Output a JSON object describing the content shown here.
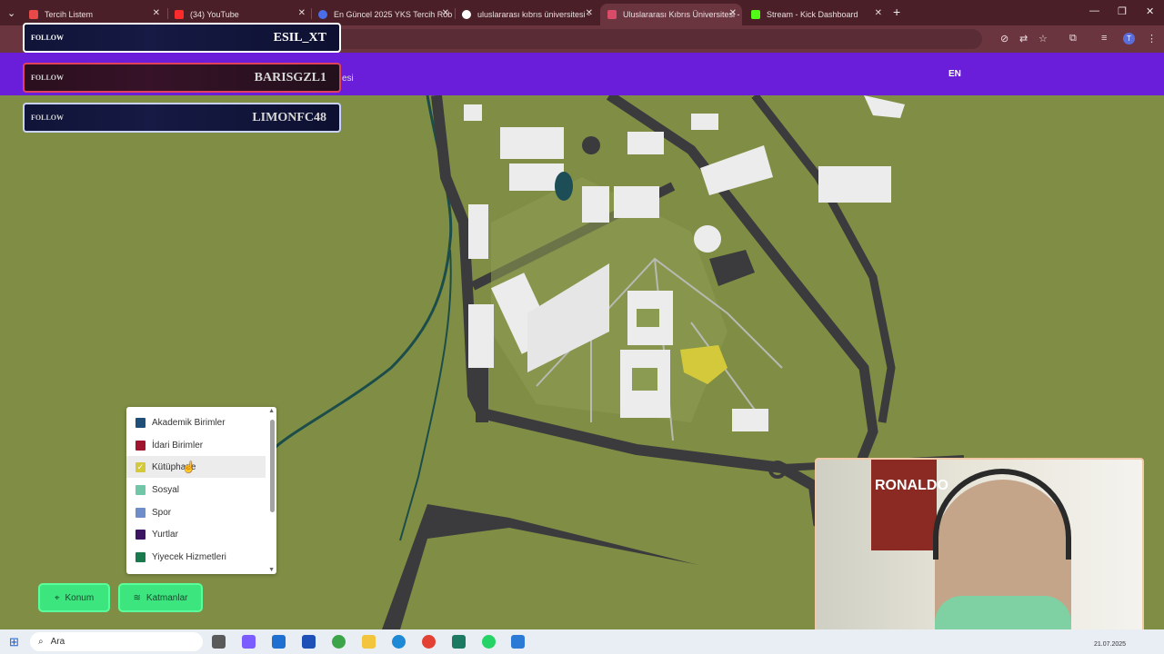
{
  "browser": {
    "tabs": [
      {
        "title": "Tercih Listem",
        "color": "#e84a4a"
      },
      {
        "title": "(34) YouTube",
        "color": "#ff2b2b"
      },
      {
        "title": "En Güncel 2025 YKS Tercih Rob",
        "color": "#4a6ee8"
      },
      {
        "title": "uluslararası kıbrıs üniversitesi -",
        "color": "#ffffff"
      },
      {
        "title": "Uluslararası Kıbrıs Üniversitesi -",
        "color": "#d84c6a"
      },
      {
        "title": "Stream - Kick Dashboard",
        "color": "#53fc18"
      }
    ],
    "active_tab": 4,
    "new_tab_label": "+",
    "close_label": "✕"
  },
  "site": {
    "lang_label": "EN",
    "title_fragment": "esi"
  },
  "overlay": {
    "follows": [
      {
        "label": "FOLLOW",
        "name": "ESIL_XT"
      },
      {
        "label": "FOLLOW",
        "name": "BARISGZL1"
      },
      {
        "label": "FOLLOW",
        "name": "LIMONFC48"
      }
    ]
  },
  "legend": {
    "items": [
      {
        "label": "Akademik Birimler",
        "color": "#1f4e79",
        "checked": false
      },
      {
        "label": "İdari Birimler",
        "color": "#a0142e",
        "checked": false
      },
      {
        "label": "Kütüphane",
        "color": "#d4c93a",
        "checked": true
      },
      {
        "label": "Sosyal",
        "color": "#6fc7a8",
        "checked": false
      },
      {
        "label": "Spor",
        "color": "#6f8ec9",
        "checked": false
      },
      {
        "label": "Yurtlar",
        "color": "#3b1462",
        "checked": false
      },
      {
        "label": "Yiyecek Hizmetleri",
        "color": "#1b7a4d",
        "checked": false
      }
    ]
  },
  "controls": {
    "konum_label": "Konum",
    "katmanlar_label": "Katmanlar"
  },
  "webcam": {
    "poster_text": "RONALDO"
  },
  "taskbar": {
    "search_placeholder": "Ara",
    "date": "21.07.2025"
  },
  "colors": {
    "ground": "#7f8e44",
    "road": "#3b3a3d",
    "building": "#ececec",
    "library": "#d4c93a",
    "accent": "#6a1ed9",
    "button": "#3de57f"
  }
}
